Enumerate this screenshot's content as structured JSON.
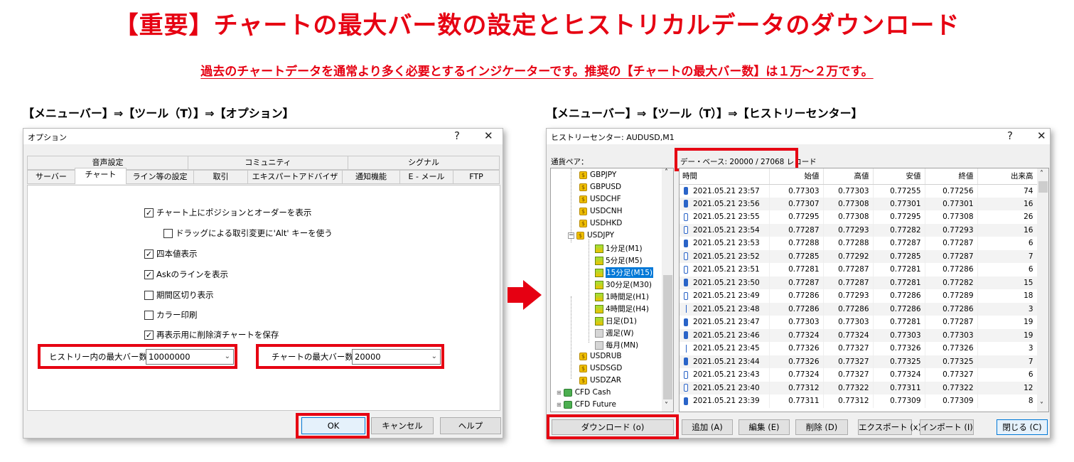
{
  "title": "【重要】チャートの最大バー数の設定とヒストリカルデータのダウンロード",
  "subtitle": "過去のチャートデータを通常より多く必要とするインジケーターです。推奨の【チャートの最大バー数】は１万～２万です。",
  "left_path": "【メニューバー】⇒【ツール（T）】⇒【オプション】",
  "right_path": "【メニューバー】⇒【ツール（T）】⇒【ヒストリーセンター】",
  "options": {
    "window_title": "オプション",
    "help_glyph": "?",
    "close_glyph": "✕",
    "tabs_row1": [
      "音声設定",
      "コミュニティ",
      "シグナル"
    ],
    "tabs_row2": [
      "サーバー",
      "チャート",
      "ライン等の設定",
      "取引",
      "エキスパートアドバイザ",
      "通知機能",
      "E - メール",
      "FTP"
    ],
    "checkboxes": [
      {
        "label": "チャート上にポジションとオーダーを表示",
        "checked": true
      },
      {
        "label": "ドラッグによる取引変更に'Alt' キーを使う",
        "checked": false
      },
      {
        "label": "四本値表示",
        "checked": true
      },
      {
        "label": "Askのラインを表示",
        "checked": true
      },
      {
        "label": "期間区切り表示",
        "checked": false
      },
      {
        "label": "カラー印刷",
        "checked": false
      },
      {
        "label": "再表示用に削除済チャートを保存",
        "checked": true
      }
    ],
    "history_max_label": "ヒストリー内の最大バー数",
    "history_max_value": "10000000",
    "chart_max_label": "チャートの最大バー数：",
    "chart_max_value": "20000",
    "ok": "OK",
    "cancel": "キャンセル",
    "help": "ヘルプ"
  },
  "history": {
    "window_title": "ヒストリーセンター: AUDUSD,M1",
    "help_glyph": "?",
    "close_glyph": "✕",
    "pairs_label": "通貨ペア：",
    "db_label": "デー・ベース: 20000 / 27068 レコード",
    "tree": {
      "symbols_top": [
        "GBPJPY",
        "GBPUSD",
        "USDCHF",
        "USDCNH",
        "USDHKD",
        "USDJPY"
      ],
      "timeframes": [
        {
          "label": "1分足(M1)",
          "has_data": true
        },
        {
          "label": "5分足(M5)",
          "has_data": true
        },
        {
          "label": "15分足(M15)",
          "has_data": true,
          "selected": true
        },
        {
          "label": "30分足(M30)",
          "has_data": true
        },
        {
          "label": "1時間足(H1)",
          "has_data": true
        },
        {
          "label": "4時間足(H4)",
          "has_data": true
        },
        {
          "label": "日足(D1)",
          "has_data": true
        },
        {
          "label": "週足(W)",
          "has_data": false
        },
        {
          "label": "毎月(MN)",
          "has_data": false
        }
      ],
      "symbols_bottom": [
        "USDRUB",
        "USDSGD",
        "USDZAR"
      ],
      "groups": [
        "CFD Cash",
        "CFD Future"
      ]
    },
    "columns": [
      "時間",
      "始値",
      "高値",
      "安値",
      "終値",
      "出来高"
    ],
    "rows": [
      {
        "kind": "bull",
        "time": "2021.05.21 23:57",
        "open": "0.77303",
        "high": "0.77303",
        "low": "0.77255",
        "close": "0.77256",
        "volume": "74"
      },
      {
        "kind": "bull",
        "time": "2021.05.21 23:56",
        "open": "0.77307",
        "high": "0.77308",
        "low": "0.77301",
        "close": "0.77301",
        "volume": "16"
      },
      {
        "kind": "bear",
        "time": "2021.05.21 23:55",
        "open": "0.77295",
        "high": "0.77308",
        "low": "0.77295",
        "close": "0.77308",
        "volume": "26"
      },
      {
        "kind": "bear",
        "time": "2021.05.21 23:54",
        "open": "0.77287",
        "high": "0.77293",
        "low": "0.77282",
        "close": "0.77293",
        "volume": "16"
      },
      {
        "kind": "bull",
        "time": "2021.05.21 23:53",
        "open": "0.77288",
        "high": "0.77288",
        "low": "0.77287",
        "close": "0.77287",
        "volume": "6"
      },
      {
        "kind": "bear",
        "time": "2021.05.21 23:52",
        "open": "0.77285",
        "high": "0.77292",
        "low": "0.77285",
        "close": "0.77287",
        "volume": "7"
      },
      {
        "kind": "bear",
        "time": "2021.05.21 23:51",
        "open": "0.77281",
        "high": "0.77287",
        "low": "0.77281",
        "close": "0.77286",
        "volume": "6"
      },
      {
        "kind": "bull",
        "time": "2021.05.21 23:50",
        "open": "0.77287",
        "high": "0.77287",
        "low": "0.77281",
        "close": "0.77282",
        "volume": "15"
      },
      {
        "kind": "bear",
        "time": "2021.05.21 23:49",
        "open": "0.77286",
        "high": "0.77293",
        "low": "0.77286",
        "close": "0.77289",
        "volume": "18"
      },
      {
        "kind": "doji",
        "time": "2021.05.21 23:48",
        "open": "0.77286",
        "high": "0.77286",
        "low": "0.77286",
        "close": "0.77286",
        "volume": "3"
      },
      {
        "kind": "bull",
        "time": "2021.05.21 23:47",
        "open": "0.77303",
        "high": "0.77303",
        "low": "0.77281",
        "close": "0.77287",
        "volume": "19"
      },
      {
        "kind": "bull",
        "time": "2021.05.21 23:46",
        "open": "0.77324",
        "high": "0.77324",
        "low": "0.77303",
        "close": "0.77303",
        "volume": "19"
      },
      {
        "kind": "doji",
        "time": "2021.05.21 23:45",
        "open": "0.77326",
        "high": "0.77327",
        "low": "0.77326",
        "close": "0.77326",
        "volume": "3"
      },
      {
        "kind": "bull",
        "time": "2021.05.21 23:44",
        "open": "0.77326",
        "high": "0.77327",
        "low": "0.77325",
        "close": "0.77325",
        "volume": "7"
      },
      {
        "kind": "bear",
        "time": "2021.05.21 23:43",
        "open": "0.77324",
        "high": "0.77327",
        "low": "0.77324",
        "close": "0.77327",
        "volume": "6"
      },
      {
        "kind": "bear",
        "time": "2021.05.21 23:40",
        "open": "0.77312",
        "high": "0.77322",
        "low": "0.77311",
        "close": "0.77322",
        "volume": "12"
      },
      {
        "kind": "bull",
        "time": "2021.05.21 23:39",
        "open": "0.77311",
        "high": "0.77312",
        "low": "0.77309",
        "close": "0.77309",
        "volume": "8"
      }
    ],
    "buttons": {
      "download": "ダウンロード (o)",
      "add": "追加 (A)",
      "edit": "編集 (E)",
      "delete": "削除 (D)",
      "export": "エクスポート (x)",
      "import": "インポート (I)",
      "close": "閉じる (C)"
    }
  },
  "colors": {
    "accent_red": "#e60012",
    "selection_blue": "#0078d7"
  }
}
